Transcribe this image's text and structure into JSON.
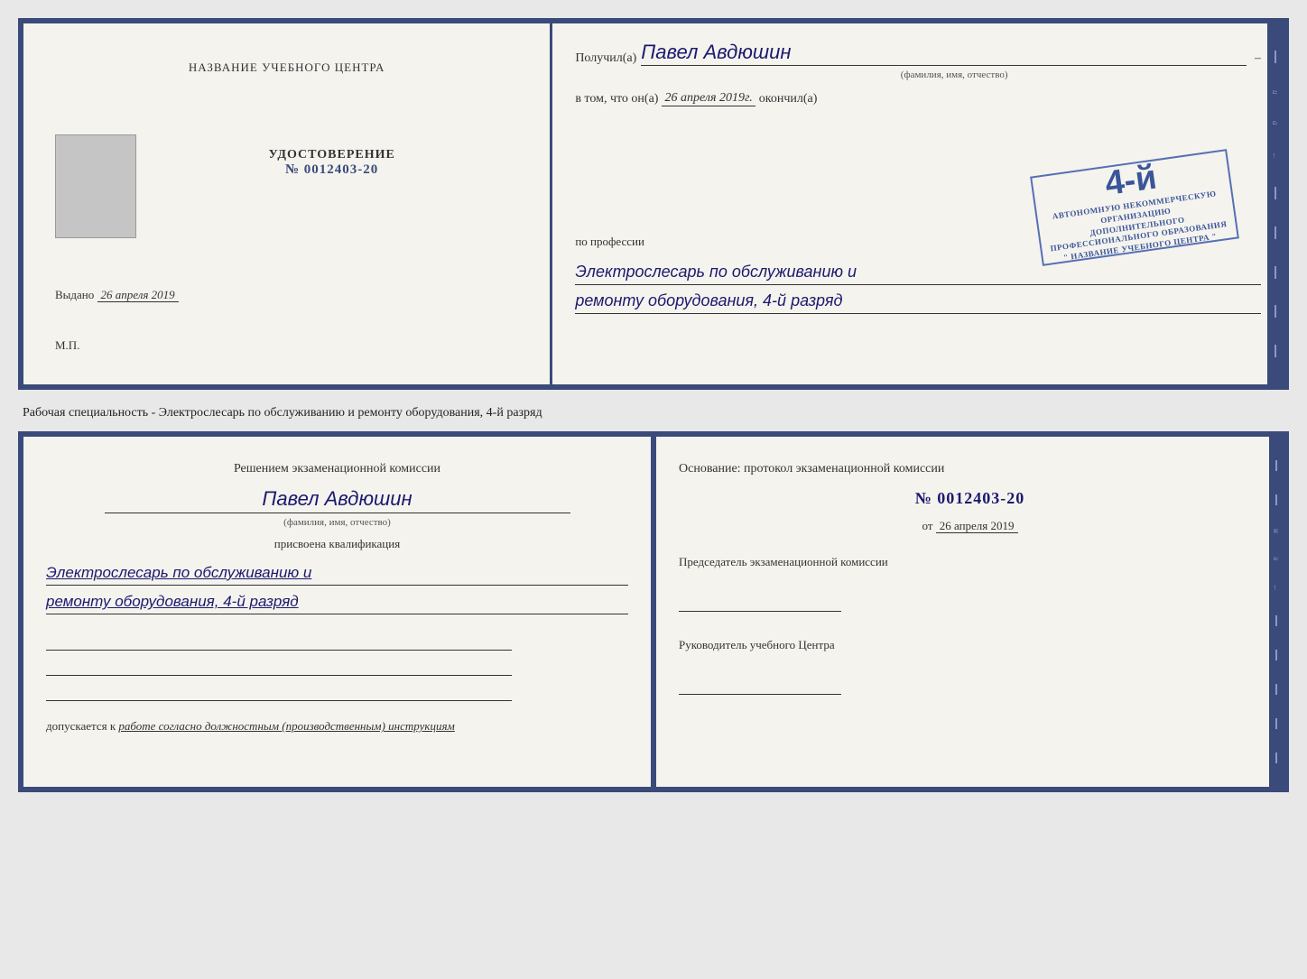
{
  "background": "#e8e8e8",
  "top_doc": {
    "left": {
      "center_name": "НАЗВАНИЕ УЧЕБНОГО ЦЕНТРА",
      "udostoverenie": "УДОСТОВЕРЕНИЕ",
      "number": "№ 0012403-20",
      "vydano_label": "Выдано",
      "vydano_date": "26 апреля 2019",
      "mp": "М.П."
    },
    "right": {
      "poluchil_label": "Получил(а)",
      "poluchil_name": "Павел Авдюшин",
      "fio_sub": "(фамилия, имя, отчество)",
      "vtom_prefix": "в том, что он(а)",
      "vtom_date": "26 апреля 2019г.",
      "okonchil": "окончил(а)",
      "stamp_number": "4-й",
      "stamp_line1": "АВТОНОМНУЮ НЕКОММЕРЧЕСКУЮ ОРГАНИЗАЦИЮ",
      "stamp_line2": "ДОПОЛНИТЕЛЬНОГО ПРОФЕССИОНАЛЬНОГО ОБРАЗОВАНИЯ",
      "stamp_line3": "\" НАЗВАНИЕ УЧЕБНОГО ЦЕНТРА \"",
      "profession_label": "по профессии",
      "profession_value": "Электрослесарь по обслуживанию и",
      "profession_value2": "ремонту оборудования, 4-й разряд"
    }
  },
  "separator": {
    "text": "Рабочая специальность - Электрослесарь по обслуживанию и ремонту оборудования, 4-й разряд"
  },
  "bottom_left": {
    "resheniem": "Решением экзаменационной комиссии",
    "person_name": "Павел Авдюшин",
    "fio_sub": "(фамилия, имя, отчество)",
    "prisvoena": "присвоена квалификация",
    "qualification1": "Электрослесарь по обслуживанию и",
    "qualification2": "ремонту оборудования, 4-й разряд",
    "dopusk_prefix": "допускается к",
    "dopusk_italic": "работе согласно должностным (производственным) инструкциям"
  },
  "bottom_right": {
    "osnovanie": "Основание: протокол экзаменационной комиссии",
    "protocol_number": "№ 0012403-20",
    "ot_label": "от",
    "ot_date": "26 апреля 2019",
    "chairman_label": "Председатель экзаменационной комиссии",
    "rukovoditel_label": "Руководитель учебного Центра"
  },
  "spine": {
    "letters": [
      "и",
      "а",
      "←",
      "–",
      "–",
      "–",
      "–",
      "–"
    ]
  }
}
